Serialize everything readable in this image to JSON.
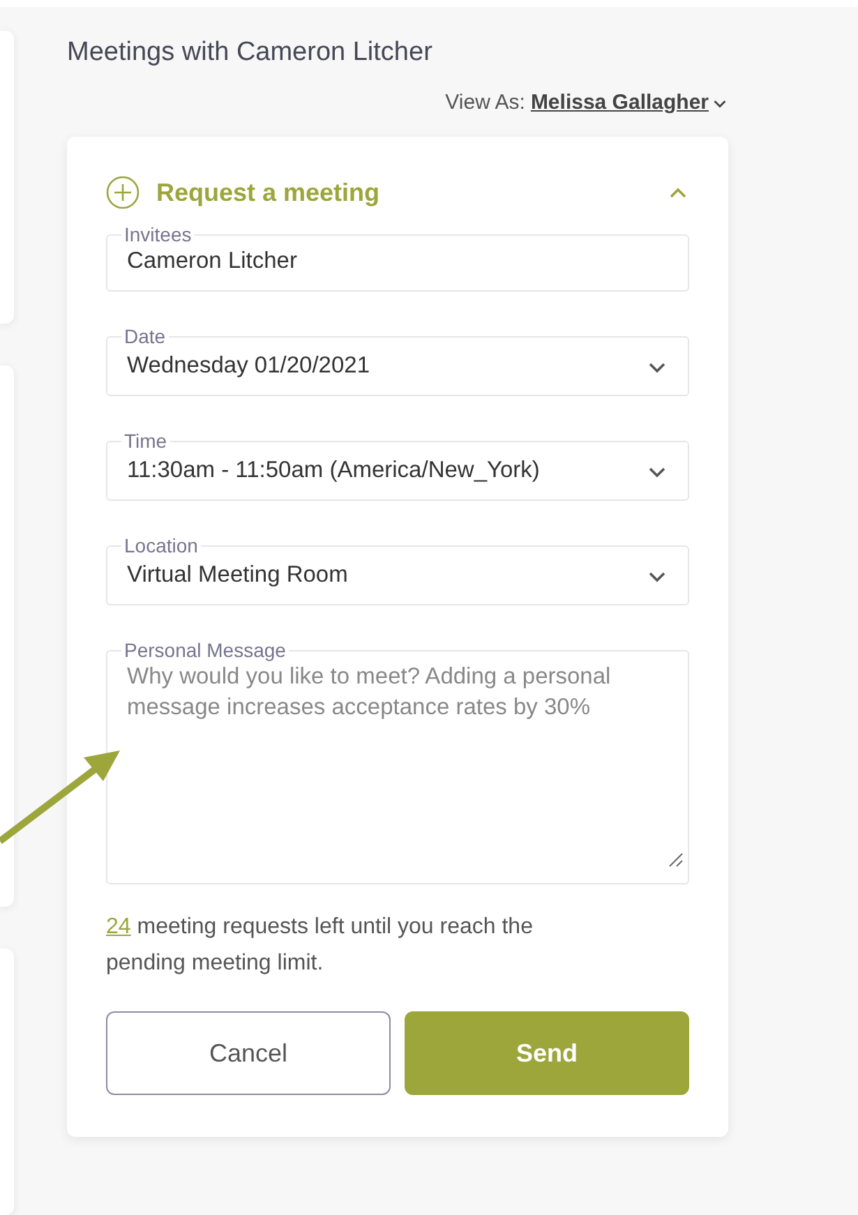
{
  "title": "Meetings with Cameron Litcher",
  "view_as": {
    "label": "View As:",
    "value": "Melissa Gallagher"
  },
  "request": {
    "title": "Request a meeting",
    "expanded": true,
    "fields": [
      {
        "kind": "text",
        "label": "Invitees",
        "value": "Cameron Litcher"
      },
      {
        "kind": "select",
        "label": "Date",
        "value": "Wednesday 01/20/2021"
      },
      {
        "kind": "select",
        "label": "Time",
        "value": "11:30am - 11:50am (America/New_York)"
      },
      {
        "kind": "select",
        "label": "Location",
        "value": "Virtual Meeting Room"
      },
      {
        "kind": "textarea",
        "label": "Personal Message",
        "placeholder": "Why would you like to meet? Adding a personal message increases acceptance rates by 30%"
      }
    ],
    "limit": {
      "count": "24",
      "text": "meeting requests left until you reach the pending meeting limit."
    },
    "buttons": [
      {
        "kind": "secondary",
        "label": "Cancel"
      },
      {
        "kind": "primary",
        "label": "Send"
      }
    ]
  }
}
